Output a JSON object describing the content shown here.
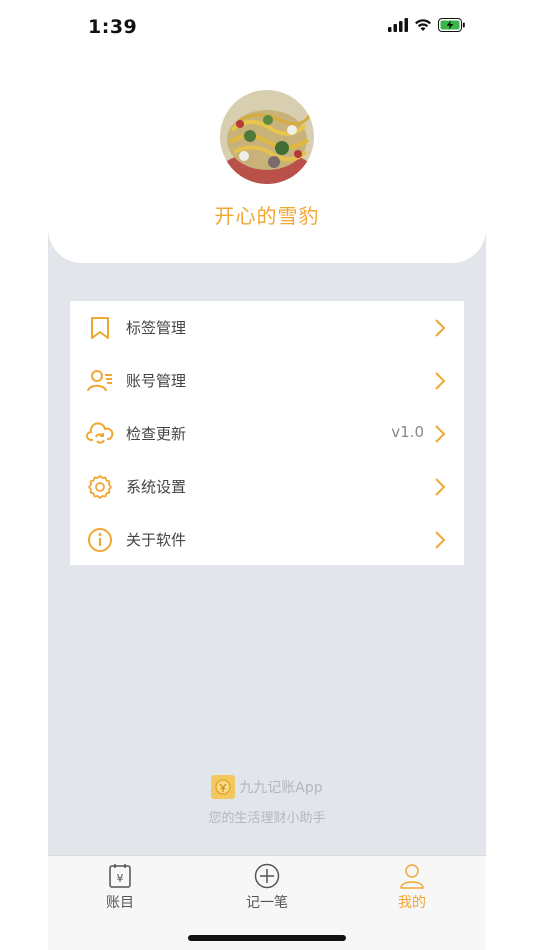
{
  "status": {
    "time": "1:39"
  },
  "profile": {
    "nickname": "开心的雪豹"
  },
  "menu": {
    "items": [
      {
        "label": "标签管理",
        "icon": "bookmark-icon",
        "value": ""
      },
      {
        "label": "账号管理",
        "icon": "user-list-icon",
        "value": ""
      },
      {
        "label": "检查更新",
        "icon": "cloud-sync-icon",
        "value": "v1.0"
      },
      {
        "label": "系统设置",
        "icon": "gear-icon",
        "value": ""
      },
      {
        "label": "关于软件",
        "icon": "info-icon",
        "value": ""
      }
    ]
  },
  "footer": {
    "app_name": "九九记账App",
    "slogan": "您的生活理财小助手"
  },
  "tabbar": {
    "tabs": [
      {
        "label": "账目",
        "icon": "ledger-icon",
        "active": false
      },
      {
        "label": "记一笔",
        "icon": "add-circle-icon",
        "active": false
      },
      {
        "label": "我的",
        "icon": "person-icon",
        "active": true
      }
    ]
  },
  "colors": {
    "accent": "#f0a734",
    "background": "#e2e5ea",
    "muted_text": "#b4b8be"
  }
}
